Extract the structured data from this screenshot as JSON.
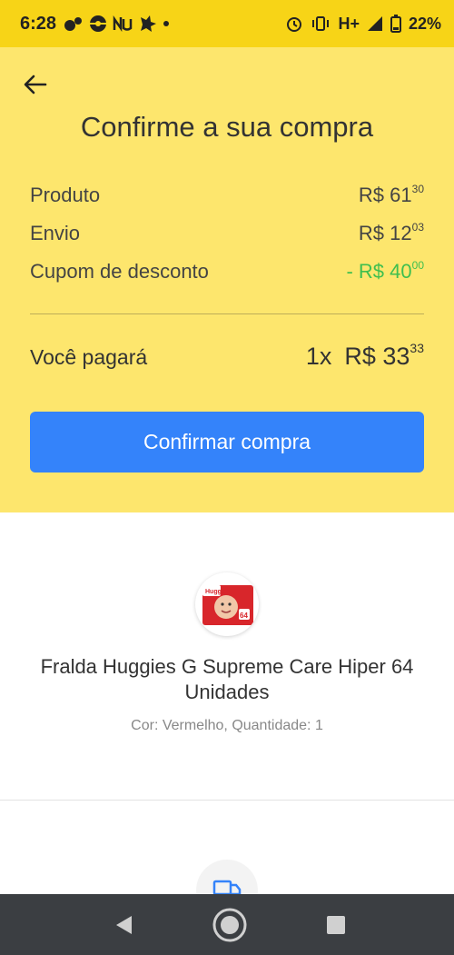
{
  "status_bar": {
    "time": "6:28",
    "network": "H+",
    "battery": "22%"
  },
  "header": {
    "title": "Confirme a sua compra"
  },
  "summary": {
    "product_label": "Produto",
    "product_price_int": "R$ 61",
    "product_price_cents": "30",
    "shipping_label": "Envio",
    "shipping_price_int": "R$ 12",
    "shipping_price_cents": "03",
    "coupon_label": "Cupom de desconto",
    "coupon_price_int": "- R$ 40",
    "coupon_price_cents": "00",
    "total_label": "Você pagará",
    "total_installments": "1x",
    "total_price_int": "R$ 33",
    "total_price_cents": "33"
  },
  "actions": {
    "confirm_label": "Confirmar compra"
  },
  "product": {
    "name": "Fralda Huggies G Supreme Care Hiper 64 Unidades",
    "attributes": "Cor: Vermelho, Quantidade: 1"
  },
  "colors": {
    "status_bar": "#f7d417",
    "header_bg": "#fde66d",
    "primary": "#3483fa",
    "discount": "#3fbf4f",
    "nav_bar": "#3b3e42"
  }
}
